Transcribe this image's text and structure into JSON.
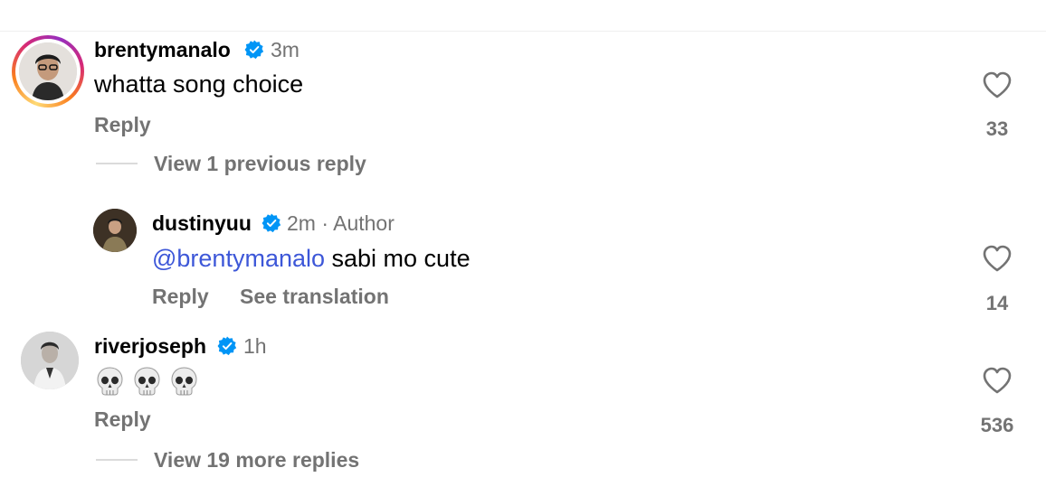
{
  "comments": [
    {
      "username": "brentymanalo",
      "time": "3m",
      "text": "whatta song choice",
      "reply_label": "Reply",
      "likes": "33",
      "thread_toggle": "View 1 previous reply"
    },
    {
      "username": "dustinyuu",
      "time": "2m · Author",
      "mention": "@brentymanalo",
      "text": " sabi mo cute",
      "reply_label": "Reply",
      "translate_label": "See translation",
      "likes": "14"
    },
    {
      "username": "riverjoseph",
      "time": "1h",
      "emoji": [
        "skull-emoji",
        "skull-emoji",
        "skull-emoji"
      ],
      "reply_label": "Reply",
      "likes": "536",
      "thread_toggle": "View 19 more replies"
    }
  ],
  "colors": {
    "username": "#000000",
    "meta": "#737373",
    "mention": "#3d57d8",
    "verified": "#0095f6"
  }
}
